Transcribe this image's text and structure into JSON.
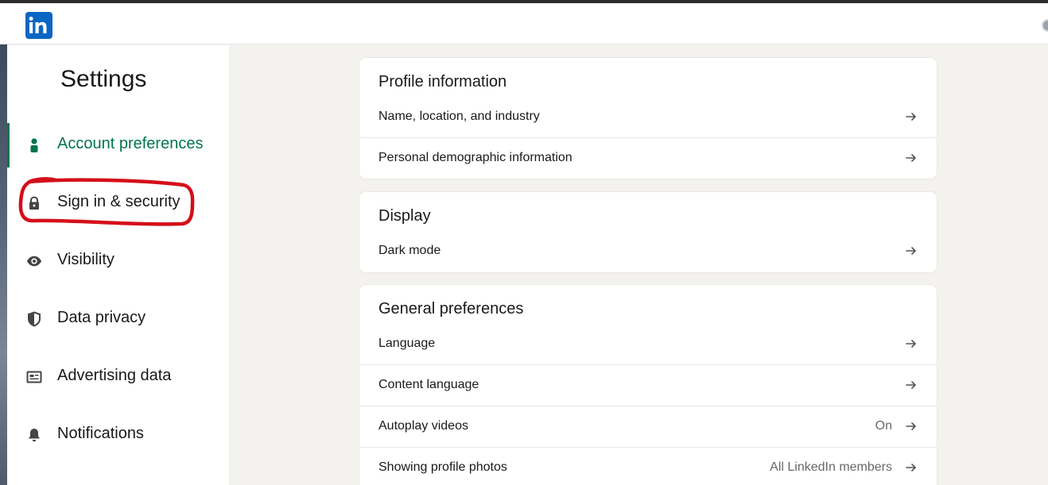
{
  "header": {
    "logo_text": "in"
  },
  "sidebar": {
    "title": "Settings",
    "items": [
      {
        "label": "Account preferences",
        "icon": "person-icon",
        "active": true
      },
      {
        "label": "Sign in & security",
        "icon": "lock-icon",
        "active": false
      },
      {
        "label": "Visibility",
        "icon": "eye-icon",
        "active": false
      },
      {
        "label": "Data privacy",
        "icon": "shield-icon",
        "active": false
      },
      {
        "label": "Advertising data",
        "icon": "newspaper-icon",
        "active": false
      },
      {
        "label": "Notifications",
        "icon": "bell-icon",
        "active": false
      }
    ]
  },
  "sections": [
    {
      "title": "Profile information",
      "rows": [
        {
          "label": "Name, location, and industry",
          "value": ""
        },
        {
          "label": "Personal demographic information",
          "value": ""
        }
      ]
    },
    {
      "title": "Display",
      "rows": [
        {
          "label": "Dark mode",
          "value": ""
        }
      ]
    },
    {
      "title": "General preferences",
      "rows": [
        {
          "label": "Language",
          "value": ""
        },
        {
          "label": "Content language",
          "value": ""
        },
        {
          "label": "Autoplay videos",
          "value": "On"
        },
        {
          "label": "Showing profile photos",
          "value": "All LinkedIn members"
        }
      ]
    }
  ],
  "colors": {
    "brand": "#0a66c2",
    "active": "#01754f",
    "annotation": "#d40f1a",
    "page_background": "#f4f2ee"
  }
}
